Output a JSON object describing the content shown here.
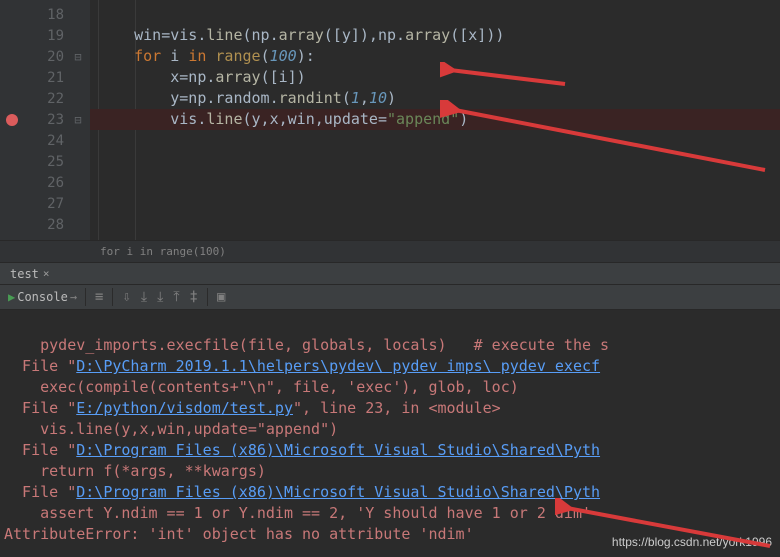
{
  "code": {
    "lines": [
      18,
      19,
      20,
      21,
      22,
      23,
      24,
      25,
      26,
      27,
      28
    ],
    "l19": {
      "pre": "    ",
      "a": "win",
      "b": "=",
      "c": "vis",
      "d": ".",
      "e": "line",
      "f": "(np.",
      "g": "array",
      "h": "([y]),np.",
      "i": "array",
      "j": "([x]))"
    },
    "l20": {
      "pre": "    ",
      "a": "for ",
      "b": "i ",
      "c": "in ",
      "d": "range",
      "e": "(",
      "f": "100",
      "g": "):"
    },
    "l21": {
      "pre": "        ",
      "a": "x=np.",
      "b": "array",
      "c": "([i])"
    },
    "l22": {
      "pre": "        ",
      "a": "y=np.random.",
      "b": "randint",
      "c": "(",
      "d": "1",
      "e": ",",
      "f": "10",
      "g": ")"
    },
    "l23": {
      "pre": "        ",
      "a": "vis.",
      "b": "line",
      "c": "(y,x,win,",
      "d": "update",
      "e": "=",
      "f": "\"append\"",
      "g": ")"
    }
  },
  "breadcrumb": "for i in range(100)",
  "tabs": {
    "tool": "test"
  },
  "toolbar": {
    "console": "Console"
  },
  "console": {
    "l1": "    pydev_imports.execfile(file, globals, locals)   # execute the s",
    "l2a": "  File \"",
    "l2b": "D:\\PyCharm 2019.1.1\\helpers\\pydev\\ pydev imps\\ pydev execf",
    "l3": "    exec(compile(contents+\"\\n\", file, 'exec'), glob, loc)",
    "l4a": "  File \"",
    "l4b": "E:/python/visdom/test.py",
    "l4c": "\", line 23, in <module>",
    "l5": "    vis.line(y,x,win,update=\"append\")",
    "l6a": "  File \"",
    "l6b": "D:\\Program Files (x86)\\Microsoft Visual Studio\\Shared\\Pyth",
    "l7": "    return f(*args, **kwargs)",
    "l8a": "  File \"",
    "l8b": "D:\\Program Files (x86)\\Microsoft Visual Studio\\Shared\\Pyth",
    "l9": "    assert Y.ndim == 1 or Y.ndim == 2, 'Y should have 1 or 2 dim'",
    "l10": "AttributeError: 'int' object has no attribute 'ndim'"
  },
  "watermark": "https://blog.csdn.net/york1996"
}
